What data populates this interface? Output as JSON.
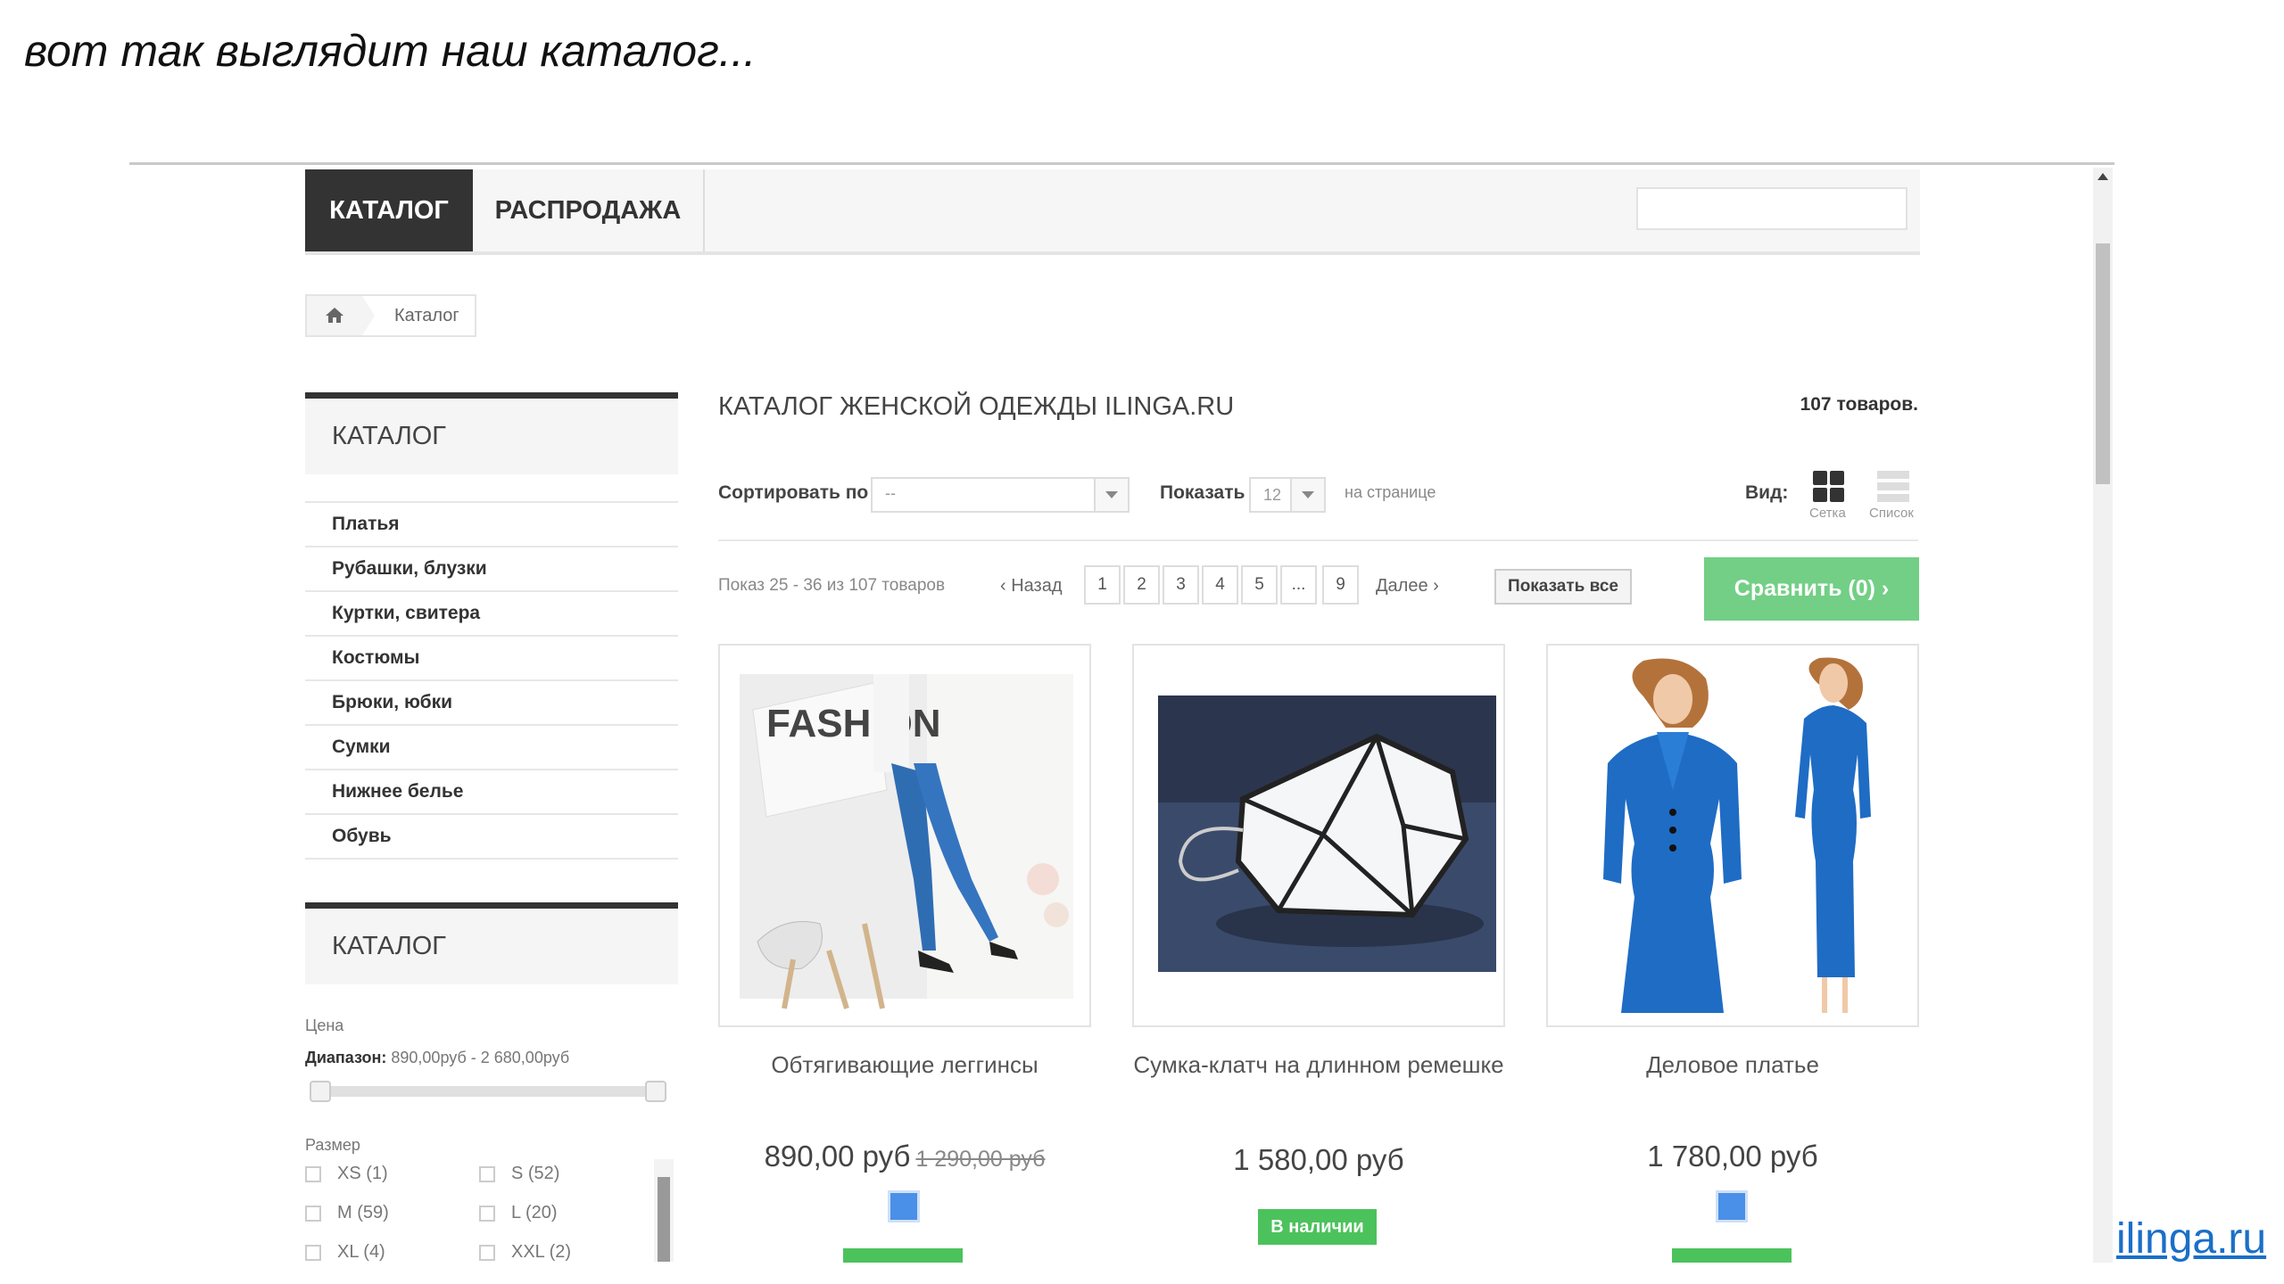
{
  "caption": "вот так выглядит наш каталог...",
  "footer_link": "ilinga.ru",
  "nav": {
    "tabs": [
      "КАТАЛОГ",
      "РАСПРОДАЖА"
    ]
  },
  "breadcrumb": {
    "home_icon": "home-icon",
    "label": "Каталог"
  },
  "sidebar": {
    "title": "КАТАЛОГ",
    "items": [
      "Платья",
      "Рубашки, блузки",
      "Куртки, свитера",
      "Костюмы",
      "Брюки, юбки",
      "Сумки",
      "Нижнее белье",
      "Обувь"
    ],
    "filter_title": "КАТАЛОГ",
    "price_label": "Цена",
    "range_label": "Диапазон:",
    "range_value": "890,00руб - 2 680,00руб",
    "price_range": [
      0,
      1
    ],
    "size_label": "Размер",
    "sizes": [
      "XS (1)",
      "S (52)",
      "M (59)",
      "L (20)",
      "XL (4)",
      "XXL (2)"
    ]
  },
  "catalog": {
    "title": "КАТАЛОГ ЖЕНСКОЙ ОДЕЖДЫ ILINGA.RU",
    "count": "107 товаров.",
    "sort_label": "Сортировать по",
    "sort_value": "--",
    "show_label": "Показать",
    "show_value": "12",
    "per_page": "на странице",
    "view_label": "Вид:",
    "view_grid": "Сетка",
    "view_list": "Список",
    "showing": "Показ 25 - 36 из 107 товаров",
    "prev": "‹ Назад",
    "pages": [
      "1",
      "2",
      "3",
      "4",
      "5",
      "...",
      "9"
    ],
    "next": "Далее ›",
    "show_all": "Показать все",
    "compare": "Сравнить (0) ›",
    "accent_color": "#72cf85",
    "stock_color": "#4cc25c"
  },
  "products": [
    {
      "name": "Обтягивающие леггинсы",
      "price": "890,00 руб",
      "old_price": "1 290,00 руб",
      "image": "leggings-photo",
      "image_text": "FASHION",
      "swatch": "#4a8fe8"
    },
    {
      "name": "Сумка-клатч на длинном ремешке",
      "price": "1 580,00 руб",
      "old_price": "",
      "image": "clutch-photo",
      "stock": "В наличии"
    },
    {
      "name": "Деловое платье",
      "price": "1 780,00 руб",
      "old_price": "",
      "image": "dress-photo",
      "swatch": "#4a8fe8"
    }
  ]
}
